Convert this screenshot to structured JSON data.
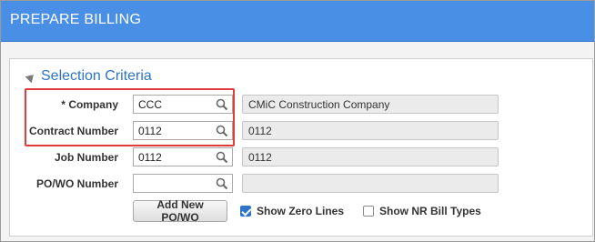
{
  "window": {
    "title": "PREPARE BILLING"
  },
  "section": {
    "title": "Selection Criteria"
  },
  "fields": {
    "company": {
      "label": "Company",
      "required_marker": "*",
      "value": "CCC",
      "description": "CMiC Construction Company"
    },
    "contract_number": {
      "label": "Contract Number",
      "value": "0112",
      "description": "0112"
    },
    "job_number": {
      "label": "Job Number",
      "value": "0112",
      "description": "0112"
    },
    "po_wo_number": {
      "label": "PO/WO Number",
      "value": "",
      "description": ""
    }
  },
  "actions": {
    "add_po_wo_label": "Add New PO/WO",
    "show_zero_lines": {
      "label": "Show Zero Lines",
      "checked": true
    },
    "show_nr_bill_types": {
      "label": "Show NR Bill Types",
      "checked": false
    }
  },
  "colors": {
    "title_bar": "#4a8fe6",
    "section_title": "#2d74c9",
    "highlight": "#e23b3b"
  }
}
